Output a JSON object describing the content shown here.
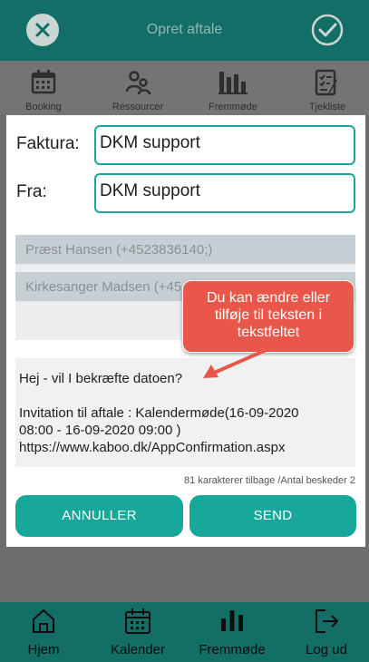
{
  "header": {
    "title": "Opret aftale"
  },
  "top_tabs": [
    {
      "label": "Booking",
      "icon": "calendar-icon"
    },
    {
      "label": "Ressourcer",
      "icon": "people-icon"
    },
    {
      "label": "Fremmøde",
      "icon": "bar-chart-icon"
    },
    {
      "label": "Tjekliste",
      "icon": "checklist-icon"
    }
  ],
  "modal": {
    "faktura_label": "Faktura:",
    "faktura_value": "DKM support",
    "fra_label": "Fra:",
    "fra_value": "DKM support",
    "recipients": [
      "Præst Hansen (+4523836140;)",
      "Kirkesanger Madsen (+45"
    ],
    "message": {
      "line1": "Hej - vil I bekræfte datoen?",
      "line2": "Invitation til aftale : Kalendermøde(16-09-2020",
      "line3": "08:00 - 16-09-2020 09:00 )",
      "line4": "https://www.kaboo.dk/AppConfirmation.aspx"
    },
    "counter": "81  karakterer tilbage  /Antal beskeder  2",
    "cancel_label": "ANNULLER",
    "send_label": "SEND"
  },
  "callout": {
    "text": "Du kan ændre eller tilføje til teksten i tekstfeltet"
  },
  "bottom_nav": [
    {
      "label": "Hjem",
      "icon": "home-icon"
    },
    {
      "label": "Kalender",
      "icon": "calendar-icon"
    },
    {
      "label": "Fremmøde",
      "icon": "bar-chart-icon"
    },
    {
      "label": "Log ud",
      "icon": "logout-icon"
    }
  ],
  "colors": {
    "primary": "#126e66",
    "accent": "#18a79b",
    "callout": "#e8574a"
  }
}
